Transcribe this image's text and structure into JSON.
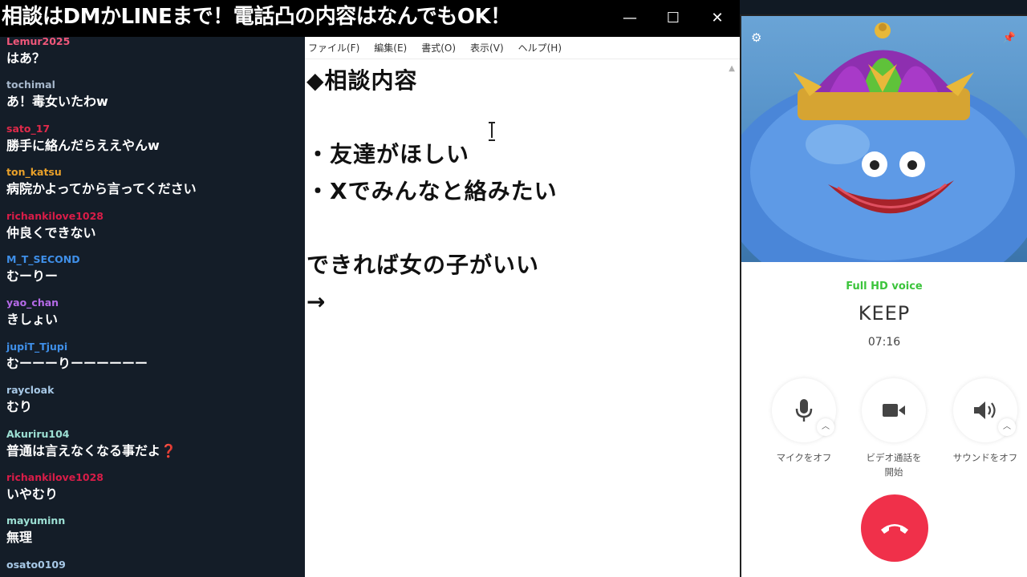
{
  "title": "相談はDMかLINEまで！電話凸の内容はなんでもOK！",
  "window_controls": {
    "minimize": "—",
    "maximize": "☐",
    "close": "✕"
  },
  "chat": {
    "messages": [
      {
        "user": "Lemur2025",
        "user_color": "#f0577a",
        "text": "はあ？"
      },
      {
        "user": "tochimal",
        "user_color": "#a7b8cc",
        "text": "あ！毒女いたわw"
      },
      {
        "user": "sato_17",
        "user_color": "#e02a4a",
        "text": "勝手に絡んだらええやんw"
      },
      {
        "user": "ton_katsu",
        "user_color": "#e8a02a",
        "text": "病院かよってから言ってください"
      },
      {
        "user": "richankilove1028",
        "user_color": "#d81d48",
        "text": "仲良くできない"
      },
      {
        "user": "M_T_SECOND",
        "user_color": "#3f8fe8",
        "text": "むーりー"
      },
      {
        "user": "yao_chan",
        "user_color": "#b56ae8",
        "text": "きしょい"
      },
      {
        "user": "jupiT_Tjupi",
        "user_color": "#3f8fe8",
        "text": "むーーーりーーーーーー"
      },
      {
        "user": "raycloak",
        "user_color": "#a7c8e6",
        "text": "むり"
      },
      {
        "user": "Akuriru104",
        "user_color": "#9de0d4",
        "text": "普通は言えなくなる事だよ",
        "emoji": "❓"
      },
      {
        "user": "richankilove1028",
        "user_color": "#d81d48",
        "text": "いやむり"
      },
      {
        "user": "mayuminn",
        "user_color": "#9de0d4",
        "text": "無理"
      },
      {
        "user": "osato0109",
        "user_color": "#a7c8e6",
        "text": ""
      }
    ]
  },
  "notepad": {
    "menu": [
      "ファイル(F)",
      "編集(E)",
      "書式(O)",
      "表示(V)",
      "ヘルプ(H)"
    ],
    "lines": [
      "◆相談内容",
      "",
      "・友達がほしい",
      "・Xでみんなと絡みたい",
      "",
      "できれば女の子がいい",
      "→"
    ]
  },
  "call": {
    "hd_voice": "Full HD voice",
    "contact_name": "KEEP",
    "timer": "07:16",
    "controls": [
      {
        "label": "マイクをオフ",
        "icon": "microphone-icon"
      },
      {
        "label": "ビデオ通話を\n開始",
        "icon": "video-camera-icon"
      },
      {
        "label": "サウンドをオフ",
        "icon": "speaker-icon"
      }
    ],
    "hangup_icon": "hang-up-icon",
    "hangup_color": "#f0304a",
    "hd_voice_color": "#3cc43c"
  }
}
